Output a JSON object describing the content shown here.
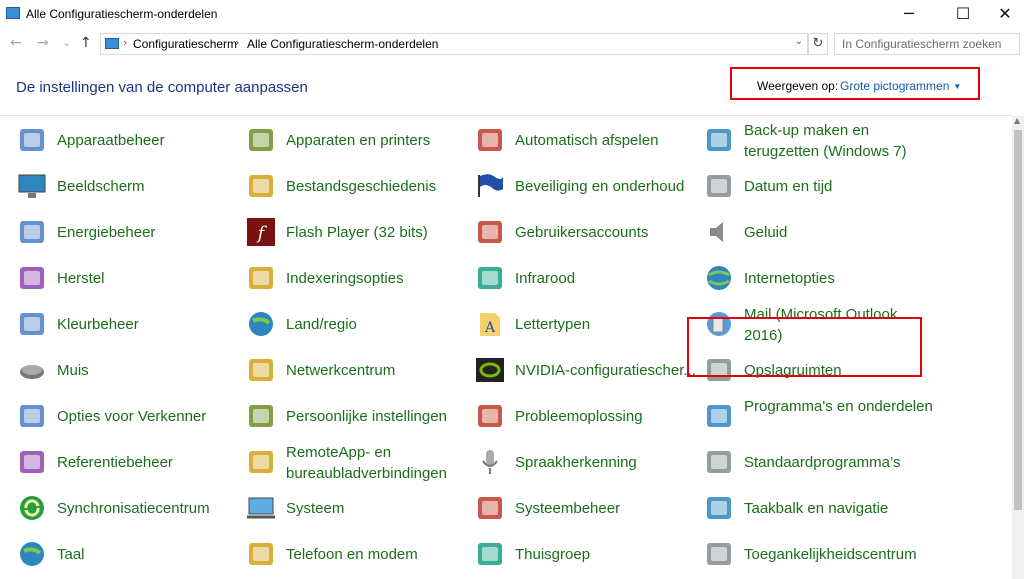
{
  "window": {
    "title": "Alle Configuratiescherm-onderdelen",
    "buttons": [
      "─",
      "☐",
      "✕"
    ]
  },
  "nav": {
    "back": "←",
    "forward": "→",
    "history": "⌄",
    "up": "↑",
    "breadcrumbs": [
      "Configuratiescherm",
      "Alle Configuratiescherm-onderdelen"
    ],
    "separator": "›",
    "dropdown": "⌄",
    "refresh": "↻",
    "search_placeholder": "In Configuratiescherm zoeken"
  },
  "header": {
    "title": "De instellingen van de computer aanpassen",
    "view_label": "Weergeven op:",
    "view_value": "Grote pictogrammen",
    "view_caret": "▼"
  },
  "items": [
    {
      "label": "Apparaatbeheer",
      "icon": "device-manager-icon"
    },
    {
      "label": "Apparaten en printers",
      "icon": "printer-icon"
    },
    {
      "label": "Automatisch afspelen",
      "icon": "autoplay-icon"
    },
    {
      "label": "Back-up maken en terugzetten (Windows 7)",
      "icon": "backup-icon"
    },
    {
      "label": "Beeldscherm",
      "icon": "display-icon"
    },
    {
      "label": "Bestandsgeschiedenis",
      "icon": "file-history-icon"
    },
    {
      "label": "Beveiliging en onderhoud",
      "icon": "flag-icon"
    },
    {
      "label": "Datum en tijd",
      "icon": "calendar-clock-icon"
    },
    {
      "label": "Energiebeheer",
      "icon": "power-icon"
    },
    {
      "label": "Flash Player (32 bits)",
      "icon": "flash-icon"
    },
    {
      "label": "Gebruikersaccounts",
      "icon": "users-icon"
    },
    {
      "label": "Geluid",
      "icon": "speaker-icon"
    },
    {
      "label": "Herstel",
      "icon": "recovery-icon"
    },
    {
      "label": "Indexeringsopties",
      "icon": "indexing-icon"
    },
    {
      "label": "Infrarood",
      "icon": "infrared-icon"
    },
    {
      "label": "Internetopties",
      "icon": "globe-icon"
    },
    {
      "label": "Kleurbeheer",
      "icon": "color-icon"
    },
    {
      "label": "Land/regio",
      "icon": "globe-clock-icon"
    },
    {
      "label": "Lettertypen",
      "icon": "font-folder-icon"
    },
    {
      "label": "Mail (Microsoft Outlook 2016)",
      "icon": "mail-icon"
    },
    {
      "label": "Muis",
      "icon": "mouse-icon"
    },
    {
      "label": "Netwerkcentrum",
      "icon": "network-icon"
    },
    {
      "label": "NVIDIA-configuratiescher...",
      "icon": "nvidia-icon"
    },
    {
      "label": "Opslagruimten",
      "icon": "storage-icon"
    },
    {
      "label": "Opties voor Verkenner",
      "icon": "folder-options-icon"
    },
    {
      "label": "Persoonlijke instellingen",
      "icon": "personalize-icon"
    },
    {
      "label": "Probleemoplossing",
      "icon": "troubleshoot-icon"
    },
    {
      "label": "Programma's en onderdelen",
      "icon": "programs-icon"
    },
    {
      "label": "Referentiebeheer",
      "icon": "credential-icon"
    },
    {
      "label": "RemoteApp- en bureaubladverbindingen",
      "icon": "remote-icon"
    },
    {
      "label": "Spraakherkenning",
      "icon": "microphone-icon"
    },
    {
      "label": "Standaardprogramma’s",
      "icon": "default-programs-icon"
    },
    {
      "label": "Synchronisatiecentrum",
      "icon": "sync-icon"
    },
    {
      "label": "Systeem",
      "icon": "system-icon"
    },
    {
      "label": "Systeembeheer",
      "icon": "admin-tools-icon"
    },
    {
      "label": "Taakbalk en navigatie",
      "icon": "taskbar-icon"
    },
    {
      "label": "Taal",
      "icon": "language-icon"
    },
    {
      "label": "Telefoon en modem",
      "icon": "phone-icon"
    },
    {
      "label": "Thuisgroep",
      "icon": "homegroup-icon"
    },
    {
      "label": "Toegankelijkheidscentrum",
      "icon": "accessibility-icon"
    }
  ],
  "colors": {
    "heading": "#1e3287",
    "item_label": "#1a6e1a",
    "link": "#0f5aa8",
    "highlight": "#e2000f"
  },
  "scrollbar": {
    "up_arrow": "▲"
  }
}
